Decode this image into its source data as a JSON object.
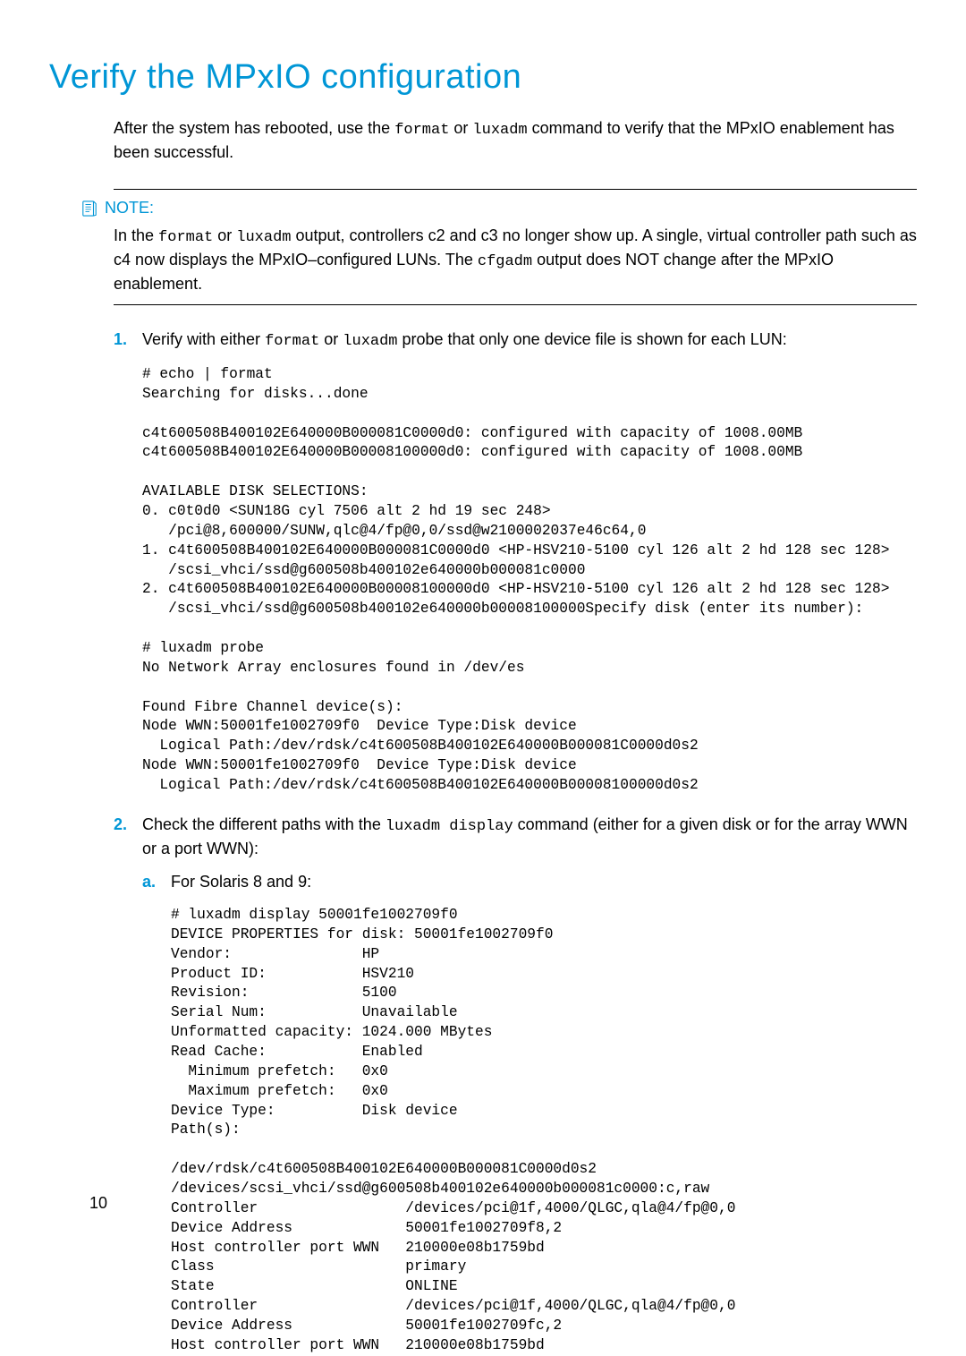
{
  "heading": "Verify the MPxIO configuration",
  "intro": {
    "pre": "After the system has rebooted, use the ",
    "cmd1": "format",
    "mid1": " or ",
    "cmd2": "luxadm",
    "post": " command to verify that the MPxIO enablement has been successful."
  },
  "note": {
    "label": "NOTE:",
    "body": {
      "pre": "In the ",
      "cmd1": "format",
      "mid1": " or ",
      "cmd2": "luxadm",
      "mid2": " output, controllers c2 and c3 no longer show up. A single, virtual controller path such as c4 now displays the MPxIO–configured LUNs. The ",
      "cmd3": "cfgadm",
      "post": " output does NOT change after the MPxIO enablement."
    }
  },
  "step1": {
    "num": "1.",
    "text": {
      "pre": "Verify with either ",
      "cmd1": "format",
      "mid1": " or ",
      "cmd2": "luxadm",
      "post": " probe that only one device file is shown for each LUN:"
    },
    "code": "# echo | format\nSearching for disks...done\n\nc4t600508B400102E640000B000081C0000d0: configured with capacity of 1008.00MB\nc4t600508B400102E640000B00008100000d0: configured with capacity of 1008.00MB\n\nAVAILABLE DISK SELECTIONS:\n0. c0t0d0 <SUN18G cyl 7506 alt 2 hd 19 sec 248>\n   /pci@8,600000/SUNW,qlc@4/fp@0,0/ssd@w2100002037e46c64,0\n1. c4t600508B400102E640000B000081C0000d0 <HP-HSV210-5100 cyl 126 alt 2 hd 128 sec 128>\n   /scsi_vhci/ssd@g600508b400102e640000b000081c0000\n2. c4t600508B400102E640000B00008100000d0 <HP-HSV210-5100 cyl 126 alt 2 hd 128 sec 128>\n   /scsi_vhci/ssd@g600508b400102e640000b00008100000Specify disk (enter its number):\n\n# luxadm probe\nNo Network Array enclosures found in /dev/es\n\nFound Fibre Channel device(s):\nNode WWN:50001fe1002709f0  Device Type:Disk device\n  Logical Path:/dev/rdsk/c4t600508B400102E640000B000081C0000d0s2\nNode WWN:50001fe1002709f0  Device Type:Disk device\n  Logical Path:/dev/rdsk/c4t600508B400102E640000B00008100000d0s2"
  },
  "step2": {
    "num": "2.",
    "text": {
      "pre": "Check the different paths with the ",
      "cmd1": "luxadm display",
      "post": " command (either for a given disk or for the array WWN or a port WWN):"
    },
    "sub": {
      "num": "a.",
      "text": "For Solaris 8 and 9:",
      "code": "# luxadm display 50001fe1002709f0\nDEVICE PROPERTIES for disk: 50001fe1002709f0\nVendor:               HP\nProduct ID:           HSV210\nRevision:             5100\nSerial Num:           Unavailable\nUnformatted capacity: 1024.000 MBytes\nRead Cache:           Enabled\n  Minimum prefetch:   0x0\n  Maximum prefetch:   0x0\nDevice Type:          Disk device\nPath(s):\n\n/dev/rdsk/c4t600508B400102E640000B000081C0000d0s2\n/devices/scsi_vhci/ssd@g600508b400102e640000b000081c0000:c,raw\nController                 /devices/pci@1f,4000/QLGC,qla@4/fp@0,0\nDevice Address             50001fe1002709f8,2\nHost controller port WWN   210000e08b1759bd\nClass                      primary\nState                      ONLINE\nController                 /devices/pci@1f,4000/QLGC,qla@4/fp@0,0\nDevice Address             50001fe1002709fc,2\nHost controller port WWN   210000e08b1759bd"
    }
  },
  "page_num": "10"
}
